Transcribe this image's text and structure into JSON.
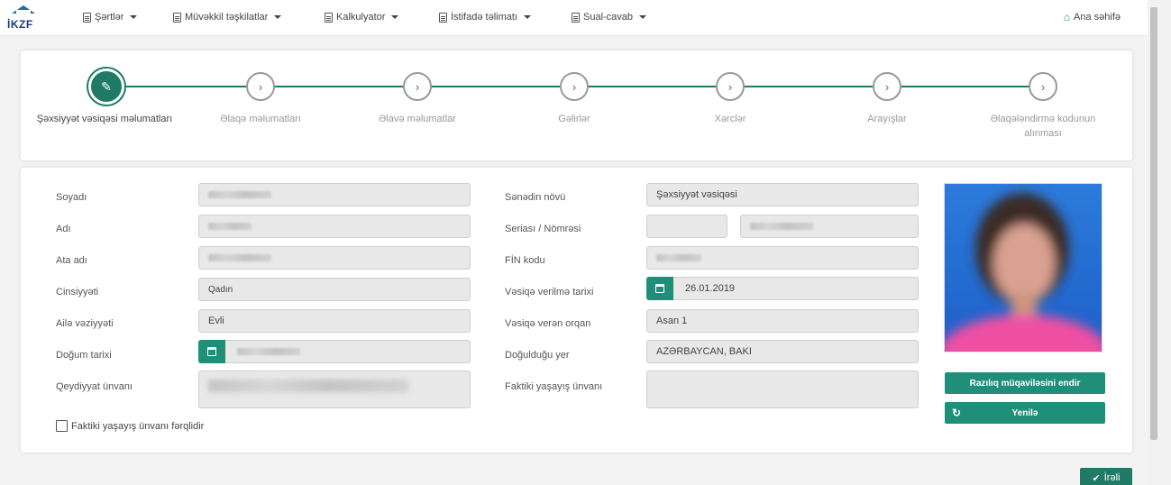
{
  "nav": {
    "logo_text": "İKZF",
    "items": [
      {
        "label": "Şərtlər"
      },
      {
        "label": "Müvəkkil təşkilatlar"
      },
      {
        "label": "Kalkulyator"
      },
      {
        "label": "İstifadə təlimatı"
      },
      {
        "label": "Sual-cavab"
      }
    ],
    "home_label": "Ana səhifə"
  },
  "wizard": {
    "steps": [
      {
        "label": "Şəxsiyyət vəsiqəsi məlumatları"
      },
      {
        "label": "Əlaqə məlumatları"
      },
      {
        "label": "Əlavə məlumatlar"
      },
      {
        "label": "Gəlirlər"
      },
      {
        "label": "Xərclər"
      },
      {
        "label": "Arayışlar"
      },
      {
        "label": "Əlaqələndirmə kodunun alınması"
      }
    ],
    "active_step": 0
  },
  "form": {
    "left": [
      {
        "label": "Soyadı",
        "value": ""
      },
      {
        "label": "Adı",
        "value": ""
      },
      {
        "label": "Ata adı",
        "value": ""
      },
      {
        "label": "Cinsiyyəti",
        "value": "Qadın"
      },
      {
        "label": "Ailə vəziyyəti",
        "value": "Evli"
      },
      {
        "label": "Doğum tarixi",
        "value": ""
      },
      {
        "label": "Qeydiyyat ünvanı",
        "value": ""
      }
    ],
    "right": [
      {
        "label": "Sənədin növü",
        "value": "Şəxsiyyət vəsiqəsi"
      },
      {
        "label": "Seriası / Nömrəsi",
        "value": ""
      },
      {
        "label": "FİN kodu",
        "value": ""
      },
      {
        "label": "Vəsiqə verilmə tarixi",
        "value": "26.01.2019"
      },
      {
        "label": "Vəsiqə verən orqan",
        "value": "Asan 1"
      },
      {
        "label": "Doğulduğu yer",
        "value": "AZƏRBAYCAN, BAKI"
      },
      {
        "label": "Faktiki yaşayış ünvanı",
        "value": ""
      }
    ],
    "checkbox_label": "Faktiki yaşayış ünvanı fərqlidir",
    "consent_button": "Razılıq müqaviləsini endir",
    "refresh_button": "Yenilə"
  },
  "next_button": "İrəli",
  "colors": {
    "accent": "#1f7a66",
    "button": "#1f8f7a"
  }
}
